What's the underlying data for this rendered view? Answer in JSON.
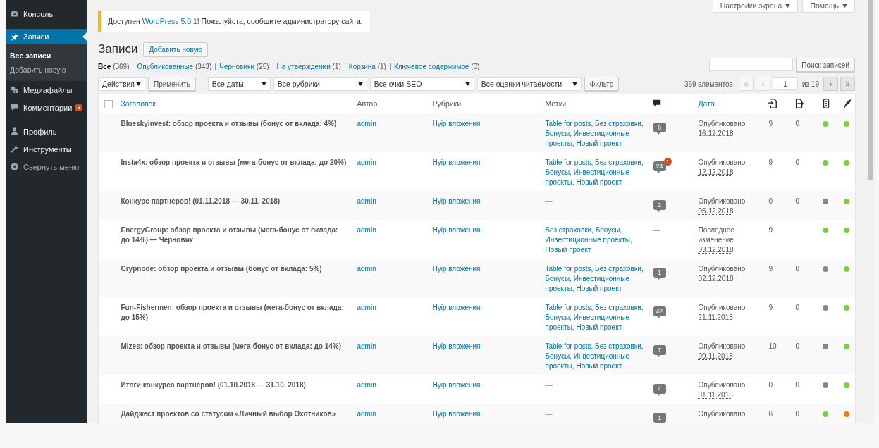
{
  "sidebar": {
    "items": [
      {
        "label": "Консоль",
        "kind": "menu",
        "selected": false
      },
      {
        "label": "Записи",
        "kind": "menu",
        "selected": true,
        "children": [
          {
            "label": "Все записи",
            "selected": true
          },
          {
            "label": "Добавить новую",
            "selected": false
          }
        ]
      },
      {
        "label": "Медиафайлы",
        "kind": "menu",
        "selected": false
      },
      {
        "label": "Комментарии",
        "kind": "menu",
        "selected": false,
        "badge": "3"
      },
      {
        "label": "Профиль",
        "kind": "menu",
        "selected": false
      },
      {
        "label": "Инструменты",
        "kind": "menu",
        "selected": false
      },
      {
        "label": "Свернуть меню",
        "kind": "collapse",
        "selected": false
      }
    ]
  },
  "screen_tabs": [
    {
      "label": "Настройки экрана"
    },
    {
      "label": "Помощь"
    }
  ],
  "notice": {
    "before": "Доступен ",
    "link": "WordPress 5.0.1",
    "after": "! Пожалуйста, сообщите администратору сайта."
  },
  "page_title": "Записи",
  "add_new": "Добавить новую",
  "status_links": [
    {
      "label": "Все",
      "count": "(369)",
      "selected": true
    },
    {
      "label": "Опубликованные",
      "count": "(343)",
      "selected": false
    },
    {
      "label": "Черновики",
      "count": "(25)",
      "selected": false
    },
    {
      "label": "На утверждении",
      "count": "(1)",
      "selected": false
    },
    {
      "label": "Корзина",
      "count": "(1)",
      "selected": false
    },
    {
      "label": "Ключевое содержимое",
      "count": "(0)",
      "selected": false
    }
  ],
  "search": {
    "button": "Поиск записей"
  },
  "toolbar": {
    "bulk_action": "Действия",
    "apply": "Применить",
    "filters": [
      "Все даты",
      "Все рубрики",
      "Все очки SEO",
      "Все оценки читаемости"
    ],
    "filter_button": "Фильтр"
  },
  "pagination": {
    "items": "369 элементов",
    "first": {
      "label": "«",
      "disabled": true
    },
    "prev": {
      "label": "‹",
      "disabled": true
    },
    "page": "1",
    "of": "из 19",
    "next": {
      "label": "›",
      "disabled": false
    },
    "last": {
      "label": "»",
      "disabled": false
    }
  },
  "table": {
    "select_all": {
      "checked": false
    },
    "columns": [
      {
        "kind": "sort",
        "label": "Заголовок"
      },
      {
        "kind": "text",
        "label": "Автор"
      },
      {
        "kind": "text",
        "label": "Рубрики"
      },
      {
        "kind": "text",
        "label": "Метки"
      },
      {
        "kind": "icon"
      },
      {
        "kind": "sort",
        "label": "Дата"
      },
      {
        "kind": "icon"
      },
      {
        "kind": "icon"
      },
      {
        "kind": "icon"
      },
      {
        "kind": "icon"
      }
    ],
    "rows": [
      {
        "title": "Blueskyinvest: обзор проекта и отзывы (бонус от вклада: 4%)",
        "author": "admin",
        "category": "Hyip вложения",
        "tags": {
          "kind": "links",
          "text": "Table for posts, Без страховки, Бонусы, Инвестиционные проекты, Новый проект"
        },
        "comments": {
          "kind": "bubble",
          "count": "6"
        },
        "status": "Опубликовано",
        "date": "16.12.2018",
        "links_in": "9",
        "links_out": "0",
        "seo": {
          "color": "#7ad03a"
        },
        "readability": {
          "color": "#7ad03a"
        }
      },
      {
        "title": "Insta4x: обзор проекта и отзывы (мега-бонус от вклада: до 20%)",
        "author": "admin",
        "category": "Hyip вложения",
        "tags": {
          "kind": "links",
          "text": "Table for posts, Без страховки, Бонусы, Инвестиционные проекты, Новый проект"
        },
        "comments": {
          "kind": "bubble",
          "count": "24",
          "pending": "1"
        },
        "status": "Опубликовано",
        "date": "12.12.2018",
        "links_in": "9",
        "links_out": "0",
        "seo": {
          "color": "#7ad03a"
        },
        "readability": {
          "color": "#7ad03a"
        }
      },
      {
        "title": "Конкурс партнеров! (01.11.2018 — 30.11. 2018)",
        "author": "admin",
        "category": "Hyip вложения",
        "tags": {
          "kind": "none",
          "text": "—"
        },
        "comments": {
          "kind": "bubble",
          "count": "2"
        },
        "status": "Опубликовано",
        "date": "05.12.2018",
        "links_in": "0",
        "links_out": "0",
        "seo": {
          "color": "#888888"
        },
        "readability": {
          "color": "#7ad03a"
        }
      },
      {
        "title": "EnergyGroup: обзор проекта и отзывы (мега-бонус от вклада: до 14%) — Черновик",
        "author": "admin",
        "category": "Hyip вложения",
        "tags": {
          "kind": "links",
          "text": "Без страховки, Бонусы, Инвестиционные проекты, Новый проект"
        },
        "comments": {
          "kind": "none",
          "text": "—"
        },
        "status": "Последнее изменение",
        "date": "03.12.2018",
        "links_in": "9",
        "seo": {
          "color": "#7ad03a"
        },
        "readability": {
          "color": "#7ad03a"
        }
      },
      {
        "title": "Crypnode: обзор проекта и отзывы (бонус от вклада: 5%)",
        "author": "admin",
        "category": "Hyip вложения",
        "tags": {
          "kind": "links",
          "text": "Table for posts, Без страховки, Бонусы, Инвестиционные проекты, Новый проект"
        },
        "comments": {
          "kind": "bubble",
          "count": "1"
        },
        "status": "Опубликовано",
        "date": "02.12.2018",
        "links_in": "9",
        "links_out": "0",
        "seo": {
          "color": "#888888"
        },
        "readability": {
          "color": "#7ad03a"
        }
      },
      {
        "title": "Fun-Fishermen: обзор проекта и отзывы (мега-бонус от вклада: до 15%)",
        "author": "admin",
        "category": "Hyip вложения",
        "tags": {
          "kind": "links",
          "text": "Table for posts, Без страховки, Бонусы, Инвестиционные проекты, Новый проект"
        },
        "comments": {
          "kind": "bubble",
          "count": "42"
        },
        "status": "Опубликовано",
        "date": "21.11.2018",
        "links_in": "9",
        "links_out": "0",
        "seo": {
          "color": "#888888"
        },
        "readability": {
          "color": "#7ad03a"
        }
      },
      {
        "title": "Mizes: обзор проекта и отзывы (мега-бонус от вклада: до 14%)",
        "author": "admin",
        "category": "Hyip вложения",
        "tags": {
          "kind": "links",
          "text": "Table for posts, Без страховки, Бонусы, Инвестиционные проекты, Новый проект"
        },
        "comments": {
          "kind": "bubble",
          "count": "7"
        },
        "status": "Опубликовано",
        "date": "09.11.2018",
        "links_in": "10",
        "links_out": "0",
        "seo": {
          "color": "#888888"
        },
        "readability": {
          "color": "#7ad03a"
        }
      },
      {
        "title": "Итоги конкурса партнеров! (01.10.2018 — 31.10. 2018)",
        "author": "admin",
        "category": "Hyip вложения",
        "tags": {
          "kind": "none",
          "text": "—"
        },
        "comments": {
          "kind": "bubble",
          "count": "4"
        },
        "status": "Опубликовано",
        "date": "01.11.2018",
        "links_in": "0",
        "links_out": "0",
        "seo": {
          "color": "#888888"
        },
        "readability": {
          "color": "#7ad03a"
        }
      },
      {
        "title": "Дайджест проектов со статусом «Личный выбор Охотников»",
        "author": "admin",
        "category": "Hyip вложения",
        "tags": {
          "kind": "none",
          "text": "—"
        },
        "comments": {
          "kind": "bubble",
          "count": "1"
        },
        "status": "Опубликовано",
        "links_in": "6",
        "links_out": "0",
        "seo": {
          "color": "#7ad03a"
        },
        "readability": {
          "color": "#ee7c1b"
        }
      }
    ]
  }
}
